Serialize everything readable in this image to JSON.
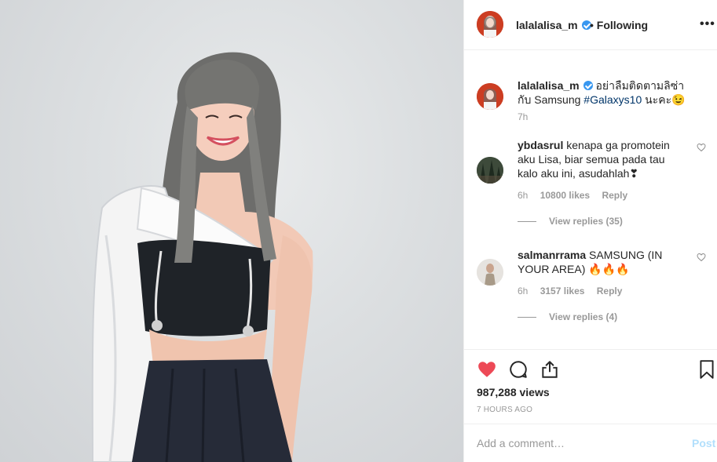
{
  "post": {
    "author": "lalalalisa_m",
    "follow_status": "• Following",
    "more_icon": "more-dots-icon",
    "more_label": "•••",
    "caption": {
      "username": "lalalalisa_m",
      "text_pre": " อย่าลืมติดตามลิซ่า กับ Samsung ",
      "hashtag": "#Galaxys10",
      "text_post": " นะคะ😉",
      "time": "7h"
    },
    "comments": [
      {
        "username": "ybdasrul",
        "text": " kenapa ga promotein aku Lisa, biar semua pada tau kalo aku ini, asudahlah❣",
        "time": "6h",
        "likes": "10800 likes",
        "reply_label": "Reply",
        "view_replies": "View replies (35)"
      },
      {
        "username": "salmanrrama",
        "text": " SAMSUNG (IN YOUR AREA) 🔥🔥🔥",
        "time": "6h",
        "likes": "3157 likes",
        "reply_label": "Reply",
        "view_replies": "View replies (4)"
      }
    ],
    "views": "987,288 views",
    "time_ago": "7 HOURS AGO",
    "add_comment_placeholder": "Add a comment…",
    "post_button": "Post"
  },
  "icons": {
    "like": "heart-filled-icon",
    "comment": "comment-bubble-icon",
    "share": "share-icon",
    "save": "bookmark-icon"
  },
  "colors": {
    "like_red": "#ed4956",
    "verified_blue": "#3897f0",
    "hashtag": "#003569",
    "post_disabled": "#b2dffc",
    "muted": "#999999"
  }
}
